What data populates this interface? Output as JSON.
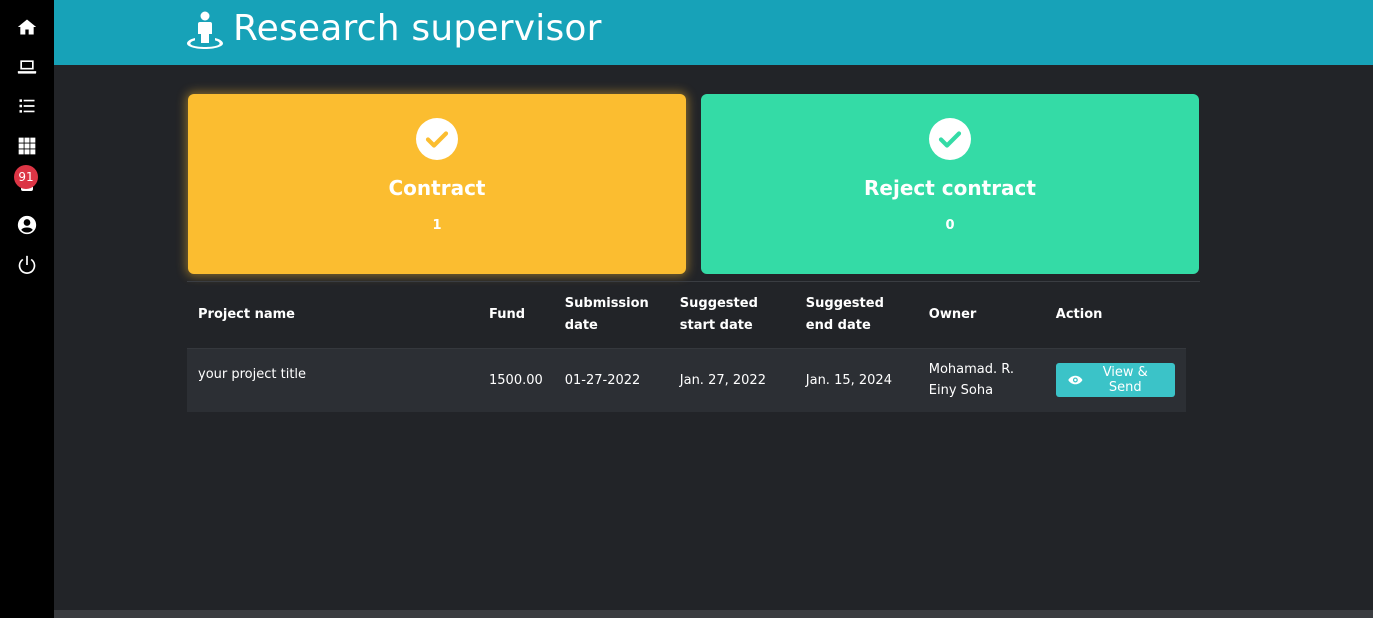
{
  "sidebar": {
    "items": [
      {
        "icon": "home-icon"
      },
      {
        "icon": "laptop-icon"
      },
      {
        "icon": "list-icon"
      },
      {
        "icon": "grid-icon"
      },
      {
        "icon": "bell-icon",
        "badge": "91"
      },
      {
        "icon": "user-circle-icon"
      },
      {
        "icon": "power-icon"
      }
    ],
    "notification_badge": "91"
  },
  "header": {
    "title": "Research supervisor",
    "icon": "user-standing-icon",
    "color": "#17a2b8"
  },
  "cards": {
    "contract": {
      "title": "Contract",
      "count": "1",
      "color": "#fbbd30",
      "icon": "check-circle-icon"
    },
    "reject": {
      "title": "Reject contract",
      "count": "0",
      "color": "#34dba6",
      "icon": "check-circle-icon"
    }
  },
  "table": {
    "headers": {
      "project_name": "Project name",
      "fund": "Fund",
      "submission_date": "Submission date",
      "suggested_start": "Suggested start date",
      "suggested_end": "Suggested end date",
      "owner": "Owner",
      "action": "Action"
    },
    "rows": [
      {
        "project_name": "your project title",
        "fund": "1500.00",
        "submission_date": "01-27-2022",
        "suggested_start": "Jan. 27, 2022",
        "suggested_end": "Jan. 15, 2024",
        "owner": "Mohamad. R. Einy Soha",
        "action_label": "View & Send",
        "action_icon": "eye-icon"
      }
    ]
  }
}
